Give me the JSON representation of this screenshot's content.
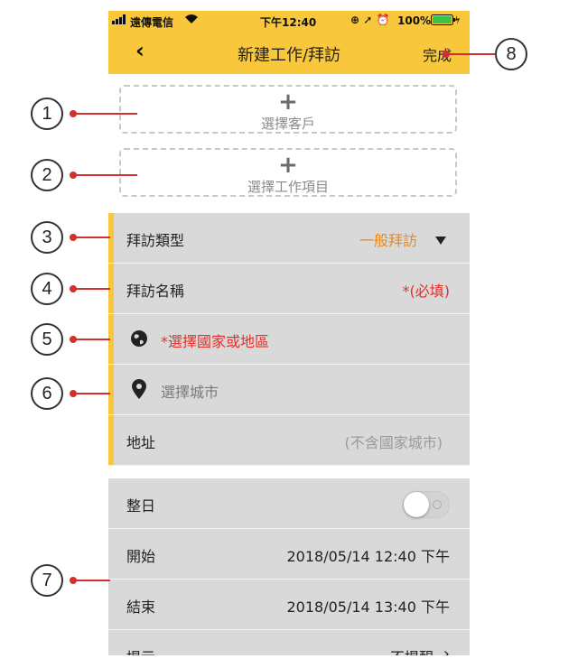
{
  "statusbar": {
    "carrier": "遠傳電信",
    "time": "下午12:40",
    "battery": "100%"
  },
  "navbar": {
    "back_icon": "‹",
    "title": "新建工作/拜訪",
    "done_label": "完成"
  },
  "pickers": {
    "customer_plus": "+",
    "customer_label": "選擇客戶",
    "project_plus": "+",
    "project_label": "選擇工作項目"
  },
  "form": {
    "visit_type_label": "拜訪類型",
    "visit_type_value": "一般拜訪",
    "visit_name_label": "拜訪名稱",
    "visit_name_required": "*(必填)",
    "country_label": "*選擇國家或地區",
    "city_label": "選擇城市",
    "address_label": "地址",
    "address_placeholder": "(不含國家城市)",
    "allday_label": "整日",
    "allday_on": false,
    "start_label": "開始",
    "start_value": "2018/05/14  12:40 下午",
    "end_label": "結束",
    "end_value": "2018/05/14  13:40 下午",
    "reminder_label": "提示",
    "reminder_value": "不提醒"
  },
  "callouts": [
    "1",
    "2",
    "3",
    "4",
    "5",
    "6",
    "7",
    "8"
  ],
  "colors": {
    "accent": "#f8c73c",
    "orange_value": "#e8891a",
    "required_red": "#e0302a",
    "pointer_red": "#d32f2f",
    "row_bg": "#d9d9d9"
  },
  "icons": {
    "globe": "globe-icon",
    "pin": "location-pin-icon",
    "caret": "caret-down-icon",
    "chevron": "chevron-right-icon"
  }
}
